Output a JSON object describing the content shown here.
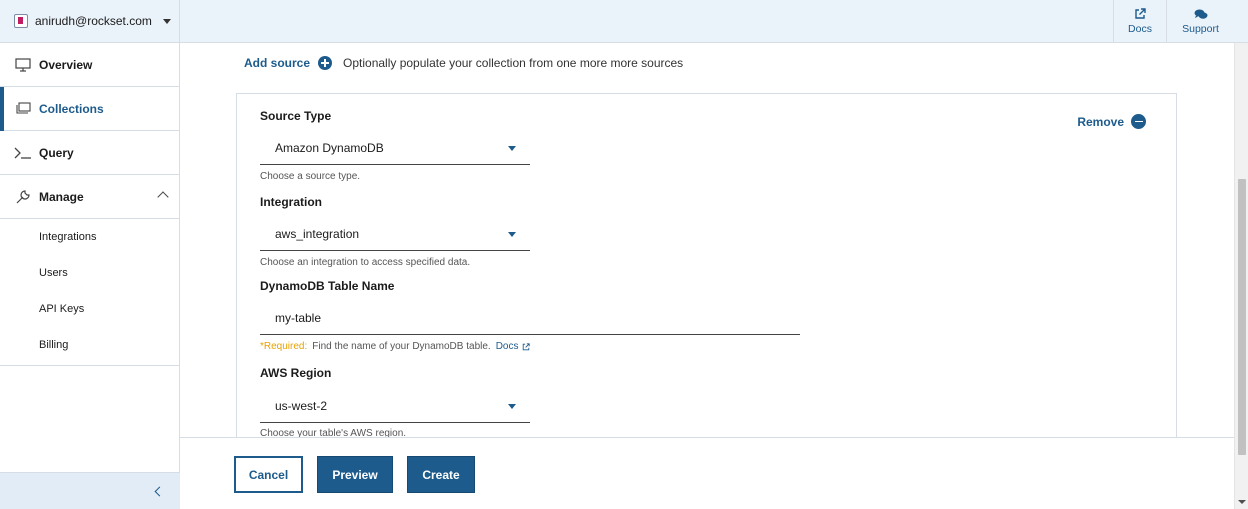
{
  "account": {
    "email": "anirudh@rockset.com"
  },
  "sidebar": {
    "items": [
      {
        "label": "Overview"
      },
      {
        "label": "Collections"
      },
      {
        "label": "Query"
      },
      {
        "label": "Manage"
      }
    ],
    "manage_sub": [
      {
        "label": "Integrations"
      },
      {
        "label": "Users"
      },
      {
        "label": "API Keys"
      },
      {
        "label": "Billing"
      }
    ]
  },
  "header": {
    "docs_label": "Docs",
    "support_label": "Support"
  },
  "main": {
    "add_source_label": "Add source",
    "add_source_desc": "Optionally populate your collection from one more more sources",
    "remove_label": "Remove",
    "source_type": {
      "label": "Source Type",
      "value": "Amazon DynamoDB",
      "helper": "Choose a source type."
    },
    "integration": {
      "label": "Integration",
      "value": "aws_integration",
      "helper": "Choose an integration to access specified data."
    },
    "table_name": {
      "label": "DynamoDB Table Name",
      "value": "my-table",
      "required": "*Required:",
      "helper": "Find the name of your DynamoDB table.",
      "docs_link": "Docs"
    },
    "aws_region": {
      "label": "AWS Region",
      "value": "us-west-2",
      "helper": "Choose your table's AWS region."
    }
  },
  "footer": {
    "cancel_label": "Cancel",
    "preview_label": "Preview",
    "create_label": "Create"
  },
  "colors": {
    "accent": "#1d5b8c",
    "header_bg": "#eaf2fa",
    "required": "#e8a200"
  }
}
